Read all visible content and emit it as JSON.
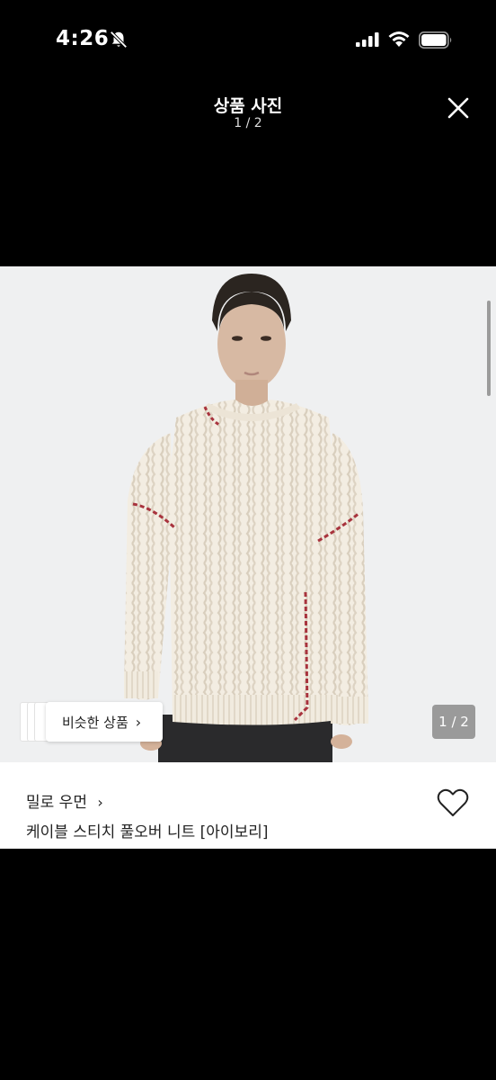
{
  "status_bar": {
    "time": "4:26",
    "icons": [
      "bell-slash-icon",
      "cellular-signal-icon",
      "wifi-icon",
      "battery-icon"
    ]
  },
  "header": {
    "title": "상품 사진",
    "counter": "1 / 2",
    "close_icon": "close-icon"
  },
  "photo": {
    "similar_button_label": "비슷한 상품",
    "similar_chevron": "›",
    "page_indicator": "1 / 2"
  },
  "product": {
    "brand": "밀로 우먼",
    "brand_chevron": "›",
    "name": "케이블 스티치 풀오버 니트 [아이보리]",
    "like_icon": "heart-outline-icon"
  },
  "colors": {
    "background": "#000000",
    "photo_bg": "#eff0f1",
    "sweater": "#f4eee3",
    "stitch": "#a8333d"
  }
}
